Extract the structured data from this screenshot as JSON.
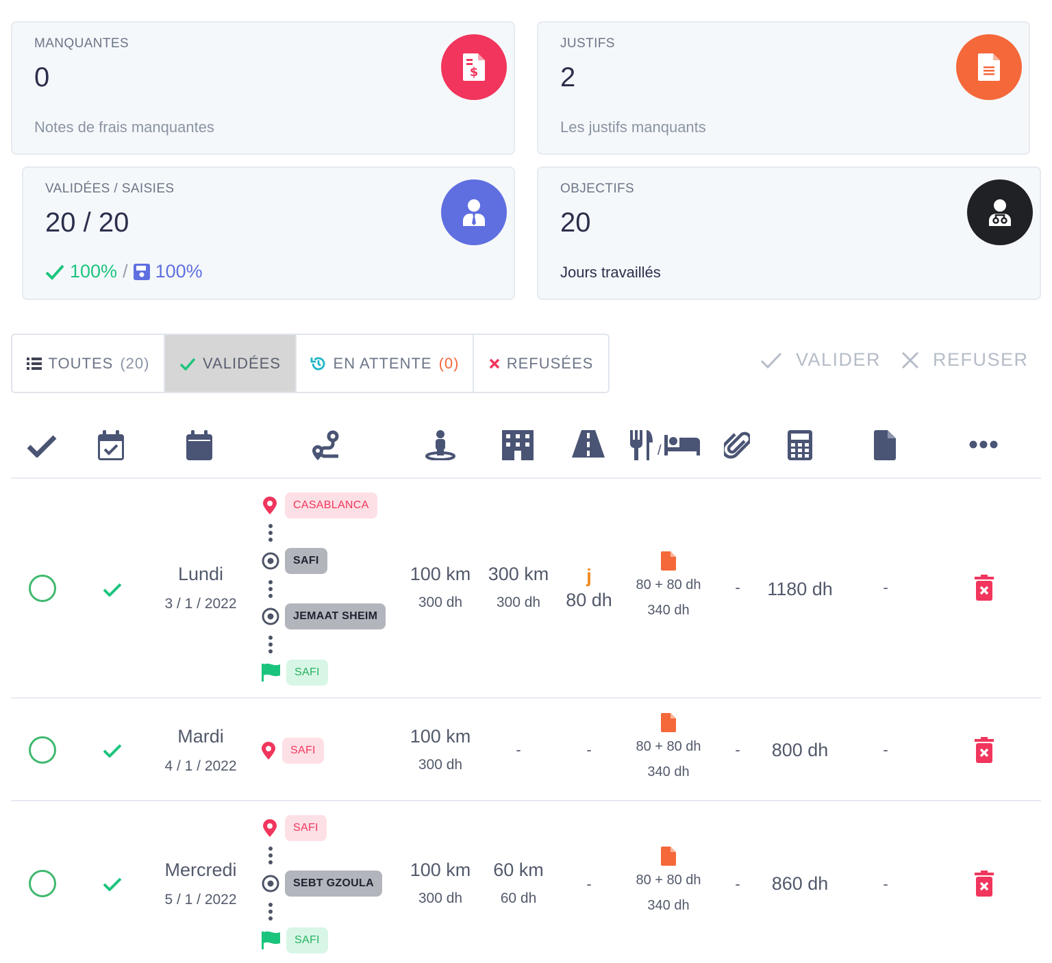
{
  "cards": [
    {
      "label": "MANQUANTES",
      "value": "0",
      "sub": "Notes de frais manquantes",
      "icon": "invoice-dollar-icon",
      "color": "#f1355c"
    },
    {
      "label": "JUSTIFS",
      "value": "2",
      "sub": "Les justifs manquants",
      "icon": "document-icon",
      "color": "#f4683a"
    },
    {
      "label": "VALIDÉES / SAISIES",
      "value": "20 / 20",
      "pct_validated": "100%",
      "pct_saved": "100%",
      "icon": "user-tie-icon",
      "color": "#5f6fe0"
    },
    {
      "label": "OBJECTIFS",
      "value": "20",
      "sub": "Jours travaillés",
      "icon": "user-doctor-icon",
      "color": "#202124"
    }
  ],
  "tabs": [
    {
      "label": "TOUTES",
      "count": "(20)"
    },
    {
      "label": "VALIDÉES"
    },
    {
      "label": "EN ATTENTE",
      "count": "(0)"
    },
    {
      "label": "REFUSÉES"
    }
  ],
  "actions": {
    "validate": "VALIDER",
    "refuse": "REFUSER"
  },
  "header_icons": [
    "check-icon",
    "calendar-check-icon",
    "calendar-icon",
    "route-icon",
    "street-view-icon",
    "building-icon",
    "road-icon",
    "utensils-bed-icon",
    "paperclip-icon",
    "calculator-icon",
    "file-icon",
    "more-icon"
  ],
  "header_sep": "/",
  "rows": [
    {
      "day": "Lundi",
      "date": "3 / 1 / 2022",
      "stops": [
        {
          "type": "start",
          "name": "CASABLANCA"
        },
        {
          "type": "via",
          "name": "SAFI"
        },
        {
          "type": "via",
          "name": "JEMAAT SHEIM"
        },
        {
          "type": "end",
          "name": "SAFI"
        }
      ],
      "km1": "100 km",
      "dh1": "300 dh",
      "km2": "300 km",
      "dh2": "300 dh",
      "toll": "80 dh",
      "toll_icon_letter": "j",
      "meal": "80 + 80 dh",
      "meal_dh": "340 dh",
      "attach": "-",
      "total": "1180 dh",
      "doc": "-"
    },
    {
      "day": "Mardi",
      "date": "4 / 1 / 2022",
      "stops": [
        {
          "type": "start",
          "name": "SAFI"
        }
      ],
      "km1": "100 km",
      "dh1": "300 dh",
      "hotel": "-",
      "toll": "-",
      "meal": "80 + 80 dh",
      "meal_dh": "340 dh",
      "attach": "-",
      "total": "800 dh",
      "doc": "-"
    },
    {
      "day": "Mercredi",
      "date": "5 / 1 / 2022",
      "stops": [
        {
          "type": "start",
          "name": "SAFI"
        },
        {
          "type": "via",
          "name": "SEBT GZOULA"
        },
        {
          "type": "end",
          "name": "SAFI"
        }
      ],
      "km1": "100 km",
      "dh1": "300 dh",
      "km2": "60 km",
      "dh2": "60 dh",
      "toll": "-",
      "meal": "80 + 80 dh",
      "meal_dh": "340 dh",
      "attach": "-",
      "total": "860 dh",
      "doc": "-"
    }
  ]
}
